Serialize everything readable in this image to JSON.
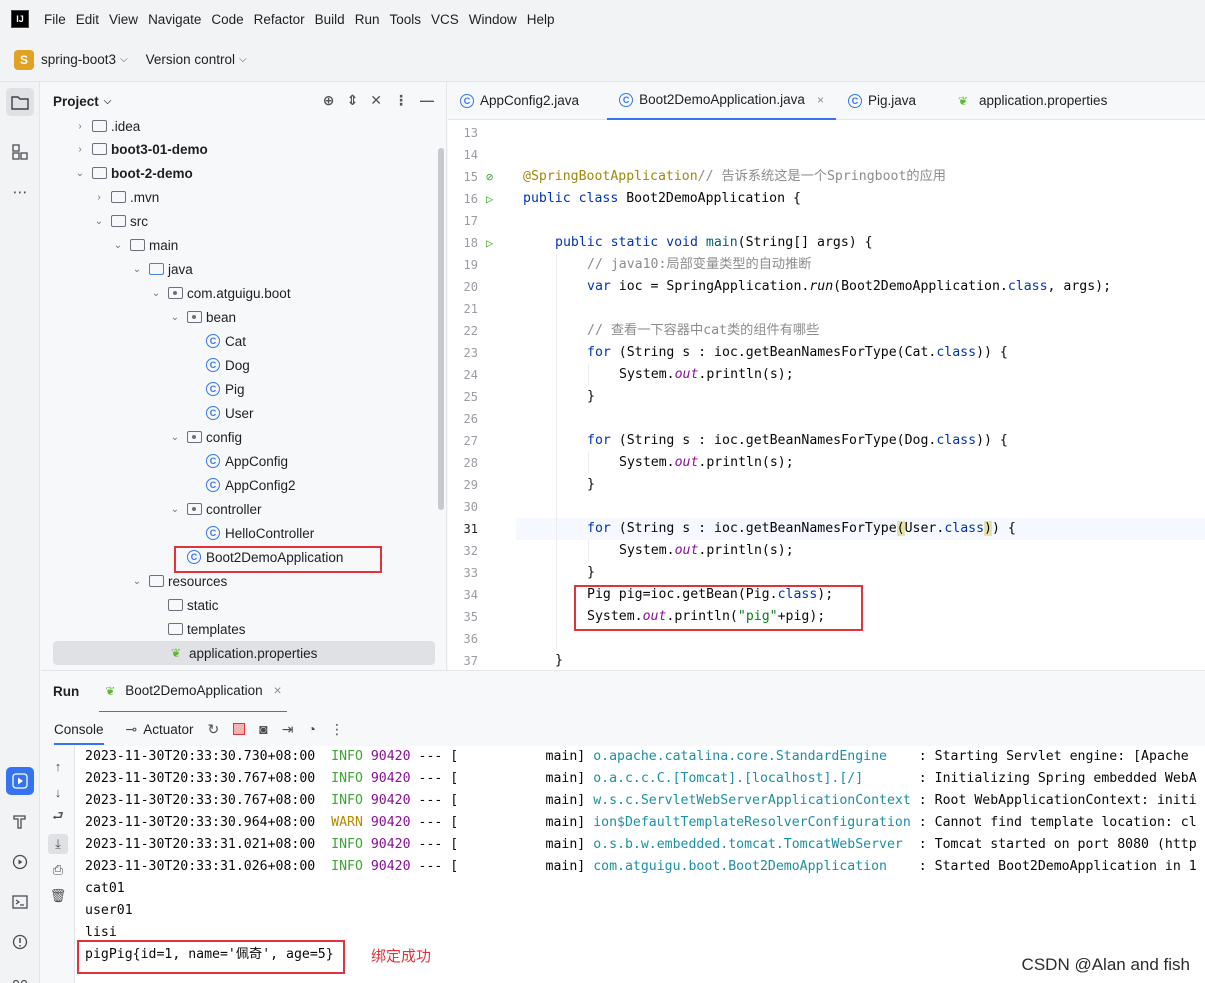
{
  "menubar": {
    "logo": "IJ",
    "items": [
      "File",
      "Edit",
      "View",
      "Navigate",
      "Code",
      "Refactor",
      "Build",
      "Run",
      "Tools",
      "VCS",
      "Window",
      "Help"
    ]
  },
  "toolbar": {
    "project_badge": "S",
    "project_name": "spring-boot3",
    "vcs_label": "Version control"
  },
  "project_panel": {
    "title": "Project",
    "tree": [
      {
        "label": ".idea",
        "depth": 2,
        "icon": "folder",
        "arrow": ">"
      },
      {
        "label": "boot3-01-demo",
        "depth": 2,
        "icon": "module",
        "arrow": ">",
        "bold": true
      },
      {
        "label": "boot-2-demo",
        "depth": 2,
        "icon": "module",
        "arrow": "v",
        "bold": true
      },
      {
        "label": ".mvn",
        "depth": 3,
        "icon": "folder",
        "arrow": ">"
      },
      {
        "label": "src",
        "depth": 3,
        "icon": "folder",
        "arrow": "v"
      },
      {
        "label": "main",
        "depth": 4,
        "icon": "folder",
        "arrow": "v"
      },
      {
        "label": "java",
        "depth": 5,
        "icon": "folder-blue",
        "arrow": "v"
      },
      {
        "label": "com.atguigu.boot",
        "depth": 6,
        "icon": "package",
        "arrow": "v"
      },
      {
        "label": "bean",
        "depth": 7,
        "icon": "package",
        "arrow": "v"
      },
      {
        "label": "Cat",
        "depth": 8,
        "icon": "class"
      },
      {
        "label": "Dog",
        "depth": 8,
        "icon": "class"
      },
      {
        "label": "Pig",
        "depth": 8,
        "icon": "class"
      },
      {
        "label": "User",
        "depth": 8,
        "icon": "class"
      },
      {
        "label": "config",
        "depth": 7,
        "icon": "package",
        "arrow": "v"
      },
      {
        "label": "AppConfig",
        "depth": 8,
        "icon": "class"
      },
      {
        "label": "AppConfig2",
        "depth": 8,
        "icon": "class"
      },
      {
        "label": "controller",
        "depth": 7,
        "icon": "package",
        "arrow": "v"
      },
      {
        "label": "HelloController",
        "depth": 8,
        "icon": "class"
      },
      {
        "label": "Boot2DemoApplication",
        "depth": 7,
        "icon": "spring-class"
      },
      {
        "label": "resources",
        "depth": 5,
        "icon": "folder-res",
        "arrow": "v"
      },
      {
        "label": "static",
        "depth": 6,
        "icon": "folder"
      },
      {
        "label": "templates",
        "depth": 6,
        "icon": "folder"
      },
      {
        "label": "application.properties",
        "depth": 6,
        "icon": "leaf",
        "selected": true
      }
    ]
  },
  "editor": {
    "tabs": [
      {
        "label": "AppConfig2.java",
        "icon": "class",
        "active": false
      },
      {
        "label": "Boot2DemoApplication.java",
        "icon": "class",
        "active": true,
        "close": "×"
      },
      {
        "label": "Pig.java",
        "icon": "class",
        "active": false
      },
      {
        "label": "application.properties",
        "icon": "leaf",
        "active": false
      }
    ],
    "line_numbers": [
      "13",
      "14",
      "15",
      "16",
      "17",
      "18",
      "19",
      "20",
      "21",
      "22",
      "23",
      "24",
      "25",
      "26",
      "27",
      "28",
      "29",
      "30",
      "31",
      "32",
      "33",
      "34",
      "35",
      "36",
      "37"
    ],
    "code": {
      "l15_ann": "@SpringBootApplication",
      "l15_cm": "// 告诉系统这是一个Springboot的应用",
      "l16_kw": "public class",
      "l16_rest": " Boot2DemoApplication {",
      "l18_kw": "public static void",
      "l18_mt": "main",
      "l18_rest": "(String[] args) {",
      "l19_cm": "// java10:局部变量类型的自动推断",
      "l20_kw": "var",
      "l20_a": " ioc = SpringApplication.",
      "l20_run": "run",
      "l20_b": "(Boot2DemoApplication.",
      "l20_cls": "class",
      "l20_c": ", args);",
      "l22_cm": "// 查看一下容器中cat类的组件有哪些",
      "for_kw": "for",
      "l23_a": " (String s : ioc.getBeanNamesForType(Cat.",
      "l27_a": " (String s : ioc.getBeanNamesForType(Dog.",
      "l31_a": " (String s : ioc.getBeanNamesForType",
      "l31_open": "(",
      "l31_b": "User.",
      "l31_close": ")",
      "l31_c": ") {",
      "cls_kw": "class",
      "for_end": ")) {",
      "sys_a": "System.",
      "sys_out": "out",
      "sys_b": ".println(s);",
      "brace": "}",
      "l34_a": "Pig pig=ioc.getBean(Pig.",
      "l34_b": ");",
      "l35_a": "System.",
      "l35_b": ".println(",
      "l35_str": "\"pig\"",
      "l35_c": "+pig);",
      "l37": "}"
    }
  },
  "run_panel": {
    "title": "Run",
    "tab_label": "Boot2DemoApplication",
    "tab_close": "×",
    "console_label": "Console",
    "actuator_label": "Actuator",
    "log_lines": [
      {
        "ts": "2023-11-30T20:33:30.730+08:00",
        "level": "INFO",
        "pid": "90420",
        "sep": "--- [",
        "thread": "           main]",
        "logger": "o.apache.catalina.core.StandardEngine   ",
        "msg": " : Starting Servlet engine: [Apache"
      },
      {
        "ts": "2023-11-30T20:33:30.767+08:00",
        "level": "INFO",
        "pid": "90420",
        "sep": "--- [",
        "thread": "           main]",
        "logger": "o.a.c.c.C.[Tomcat].[localhost].[/]      ",
        "msg": " : Initializing Spring embedded WebA"
      },
      {
        "ts": "2023-11-30T20:33:30.767+08:00",
        "level": "INFO",
        "pid": "90420",
        "sep": "--- [",
        "thread": "           main]",
        "logger": "w.s.c.ServletWebServerApplicationContext",
        "msg": " : Root WebApplicationContext: initi"
      },
      {
        "ts": "2023-11-30T20:33:30.964+08:00",
        "level": "WARN",
        "pid": "90420",
        "sep": "--- [",
        "thread": "           main]",
        "logger": "ion$DefaultTemplateResolverConfiguration",
        "msg": " : Cannot find template location: cl"
      },
      {
        "ts": "2023-11-30T20:33:31.021+08:00",
        "level": "INFO",
        "pid": "90420",
        "sep": "--- [",
        "thread": "           main]",
        "logger": "o.s.b.w.embedded.tomcat.TomcatWebServer ",
        "msg": " : Tomcat started on port 8080 (http"
      },
      {
        "ts": "2023-11-30T20:33:31.026+08:00",
        "level": "INFO",
        "pid": "90420",
        "sep": "--- [",
        "thread": "           main]",
        "logger": "com.atguigu.boot.Boot2DemoApplication   ",
        "msg": " : Started Boot2DemoApplication in 1"
      }
    ],
    "output_lines": [
      "cat01",
      "user01",
      "lisi",
      "pigPig{id=1, name='佩奇', age=5}"
    ]
  },
  "annotation_note": "绑定成功",
  "watermark": "CSDN @Alan and fish"
}
